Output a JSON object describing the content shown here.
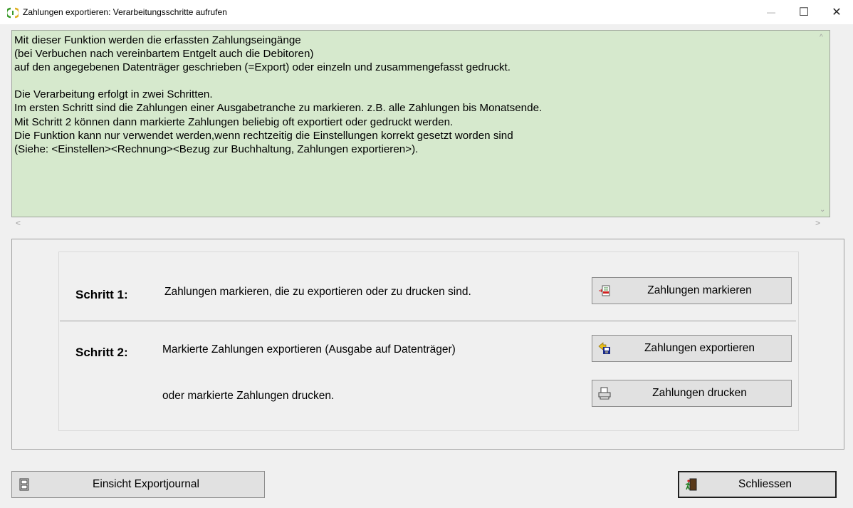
{
  "window": {
    "title": "Zahlungen exportieren: Verarbeitungsschritte aufrufen",
    "minimize": "—",
    "maximize": "☐",
    "close": "✕"
  },
  "info": {
    "text": "Mit dieser Funktion werden die erfassten Zahlungseingänge\n(bei Verbuchen nach vereinbartem Entgelt auch die Debitoren)\nauf den angegebenen Datenträger geschrieben (=Export) oder einzeln und zusammengefasst gedruckt.\n\nDie Verarbeitung erfolgt in zwei Schritten.\nIm ersten Schritt sind die Zahlungen einer Ausgabetranche zu markieren. z.B. alle Zahlungen bis Monatsende.\nMit Schritt 2 können dann markierte Zahlungen beliebig oft exportiert oder gedruckt werden.\nDie Funktion kann nur verwendet werden,wenn rechtzeitig die Einstellungen korrekt gesetzt worden sind\n(Siehe: <Einstellen><Rechnung><Bezug zur Buchhaltung, Zahlungen exportieren>)."
  },
  "scroll": {
    "up": "^",
    "down": "⌄",
    "left": "<",
    "right": ">"
  },
  "step1": {
    "label": "Schritt 1:",
    "description": "Zahlungen markieren, die zu exportieren oder zu drucken sind.",
    "button": "Zahlungen markieren"
  },
  "step2": {
    "label": "Schritt 2:",
    "description": "Markierte Zahlungen exportieren (Ausgabe auf Datenträger)",
    "button": "Zahlungen exportieren",
    "description2": "oder markierte Zahlungen drucken.",
    "button2": "Zahlungen drucken"
  },
  "footer": {
    "journal_button": "Einsicht Exportjournal",
    "close_button": "Schliessen"
  },
  "icons": {
    "app": "refresh-leaf-icon",
    "mark": "list-mark-icon",
    "export": "disk-export-icon",
    "print": "printer-icon",
    "journal": "journal-icon",
    "exit": "exit-door-icon"
  },
  "colors": {
    "info_bg": "#d6e9cd",
    "window_bg": "#f0f0f0",
    "button_bg": "#e1e1e1"
  }
}
